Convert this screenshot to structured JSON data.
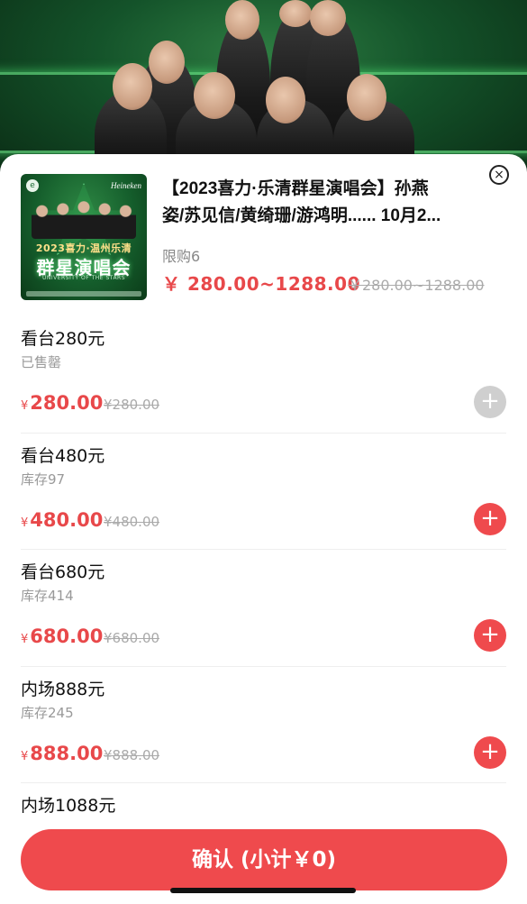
{
  "header": {
    "title_line1": "【2023喜力·乐清群星演唱会】孙燕",
    "title_line2": "姿/苏见信/黄绮珊/游鸿明...... 10月2...",
    "limit_label": "限购6",
    "price_range": "￥ 280.00~1288.00",
    "price_range_original": "￥280.00~1288.00",
    "close_icon": "×"
  },
  "poster": {
    "brand": "Heineken",
    "logo": "e",
    "subtitle": "2023喜力·温州乐清",
    "main_title": "群星演唱会",
    "english": "UNIVERSITY OF THE STARS"
  },
  "items": [
    {
      "name": "看台280元",
      "stock": "已售罄",
      "price": "280.00",
      "original": "¥280.00",
      "yen": "¥",
      "add": "+"
    },
    {
      "name": "看台480元",
      "stock": "库存97",
      "price": "480.00",
      "original": "¥480.00",
      "yen": "¥",
      "add": "+"
    },
    {
      "name": "看台680元",
      "stock": "库存414",
      "price": "680.00",
      "original": "¥680.00",
      "yen": "¥",
      "add": "+"
    },
    {
      "name": "内场888元",
      "stock": "库存245",
      "price": "888.00",
      "original": "¥888.00",
      "yen": "¥",
      "add": "+"
    },
    {
      "name": "内场1088元"
    }
  ],
  "confirm_label": "确认 (小计￥0)",
  "colors": {
    "accent": "#ef4a4d",
    "disabled": "#cfcfcf"
  }
}
